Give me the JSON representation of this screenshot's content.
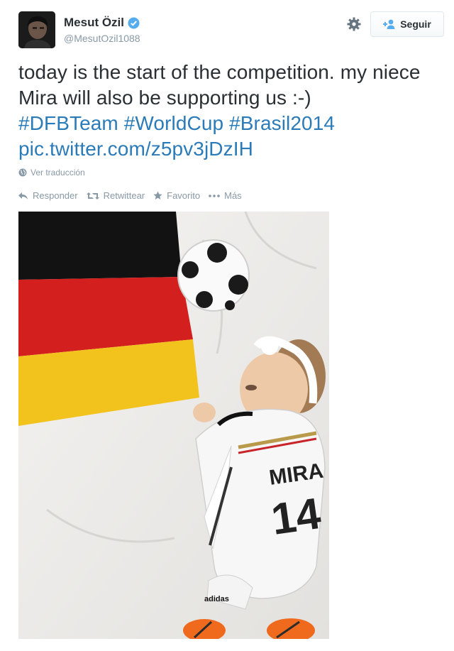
{
  "profile": {
    "display_name": "Mesut Özil",
    "handle": "@MesutOzil1088"
  },
  "follow_button": {
    "label": "Seguir"
  },
  "tweet": {
    "text_plain": "today is the start of the competition. my niece Mira will also be supporting us :-)",
    "hashtags": [
      "#DFBTeam",
      "#WorldCup",
      "#Brasil2014"
    ],
    "link": "pic.twitter.com/z5pv3jDzIH"
  },
  "translate": {
    "label": "Ver traducción"
  },
  "actions": {
    "reply": "Responder",
    "retweet": "Retwittear",
    "favorite": "Favorito",
    "more": "Más"
  },
  "photo": {
    "jersey_name": "MIRA",
    "jersey_number": "14",
    "brand": "adidas"
  },
  "colors": {
    "link": "#2b7bb9",
    "muted": "#8899a6",
    "verified": "#55acee"
  }
}
